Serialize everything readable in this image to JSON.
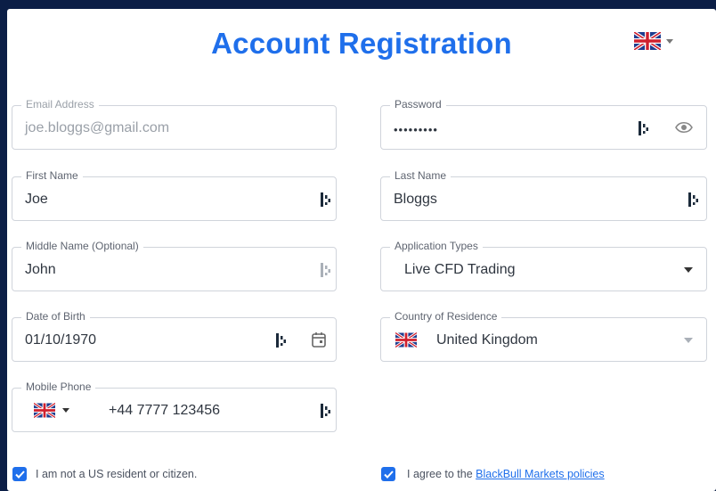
{
  "page": {
    "title": "Account Registration"
  },
  "fields": {
    "email": {
      "label": "Email Address",
      "value": "joe.bloggs@gmail.com"
    },
    "password": {
      "label": "Password",
      "value": "•••••••••"
    },
    "first_name": {
      "label": "First Name",
      "value": "Joe"
    },
    "last_name": {
      "label": "Last Name",
      "value": "Bloggs"
    },
    "middle_name": {
      "label": "Middle Name (Optional)",
      "value": "John"
    },
    "application_types": {
      "label": "Application Types",
      "value": "Live CFD Trading"
    },
    "dob": {
      "label": "Date of Birth",
      "value": "01/10/1970"
    },
    "country": {
      "label": "Country of Residence",
      "value": "United Kingdom"
    },
    "mobile": {
      "label": "Mobile Phone",
      "value": "+44 7777 123456"
    }
  },
  "checkboxes": {
    "us_resident": {
      "label": "I am not a US resident or citizen.",
      "checked": true
    },
    "policies": {
      "prefix": "I agree to the ",
      "link_text": "BlackBull Markets policies",
      "checked": true
    }
  },
  "icons": {
    "language": "uk-flag-icon",
    "password_manager": "key-icon",
    "show_password": "eye-icon",
    "calendar": "calendar-icon",
    "checkbox": "check-icon"
  },
  "colors": {
    "accent": "#1f6feb",
    "background": "#0b1e46"
  }
}
